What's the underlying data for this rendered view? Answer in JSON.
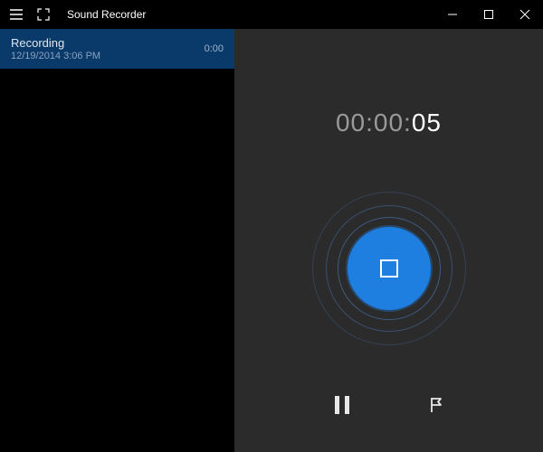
{
  "titlebar": {
    "app_title": "Sound Recorder"
  },
  "sidebar": {
    "items": [
      {
        "title": "Recording",
        "subtitle": "12/19/2014 3:06 PM",
        "duration": "0:00"
      }
    ]
  },
  "main": {
    "timer_inactive": "00:00:",
    "timer_active": "05"
  },
  "icons": {
    "hamburger": "hamburger-icon",
    "fullscreen": "fullscreen-icon",
    "minimize": "minimize-icon",
    "maximize": "maximize-icon",
    "close": "close-icon",
    "stop": "stop-icon",
    "pause": "pause-icon",
    "flag": "flag-icon"
  },
  "colors": {
    "accent": "#1e7fe0",
    "selected_bg": "#0a3a6a",
    "panel_bg": "#2b2b2b"
  }
}
